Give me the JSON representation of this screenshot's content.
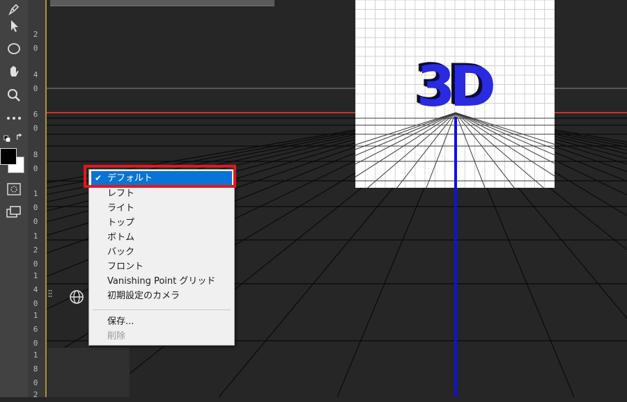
{
  "ruler": {
    "ticks": [
      "2\n0",
      "4\n0",
      "6\n0",
      "8\n0",
      "1\n0\n0",
      "1\n2\n0",
      "1\n4\n0",
      "1\n6\n0",
      "1\n8\n0",
      "2"
    ]
  },
  "toolbar": {
    "tools": [
      "pen-tool-icon",
      "path-selection-icon",
      "ellipse-tool-icon",
      "hand-tool-icon",
      "zoom-tool-icon",
      "more-tools-icon",
      "swap-colors-icon",
      "color-swatches",
      "quick-mask-icon",
      "screen-mode-icon"
    ],
    "foreground_color": "#000000",
    "background_color": "#ffffff"
  },
  "viewport": {
    "floor_color": "#000000",
    "horizon_color": "#c0392b",
    "axis_color": "#1010e0",
    "model_text": "3D"
  },
  "view_menu": {
    "items": [
      {
        "label": "デフォルト",
        "checked": true,
        "selected": true
      },
      {
        "label": "レフト"
      },
      {
        "label": "ライト"
      },
      {
        "label": "トップ"
      },
      {
        "label": "ボトム"
      },
      {
        "label": "バック"
      },
      {
        "label": "フロント"
      },
      {
        "label": "Vanishing Point グリッド"
      },
      {
        "label": "初期設定のカメラ"
      }
    ],
    "save_label": "保存...",
    "delete_label": "削除",
    "check_mark": "✔"
  }
}
